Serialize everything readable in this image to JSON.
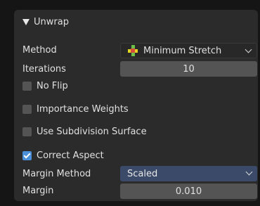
{
  "panel": {
    "title": "Unwrap",
    "method": {
      "label": "Method",
      "value": "Minimum Stretch",
      "icon": "minimum-stretch-icon"
    },
    "iterations": {
      "label": "Iterations",
      "value": "10"
    },
    "no_flip": {
      "label": "No Flip",
      "checked": false
    },
    "importance_weights": {
      "label": "Importance Weights",
      "checked": false
    },
    "use_subdivision_surface": {
      "label": "Use Subdivision Surface",
      "checked": false
    },
    "correct_aspect": {
      "label": "Correct Aspect",
      "checked": true
    },
    "margin_method": {
      "label": "Margin Method",
      "value": "Scaled"
    },
    "margin": {
      "label": "Margin",
      "value": "0.010"
    }
  },
  "colors": {
    "checkbox_on": "#4a8fd8",
    "dropdown_active": "#3c4a69"
  }
}
